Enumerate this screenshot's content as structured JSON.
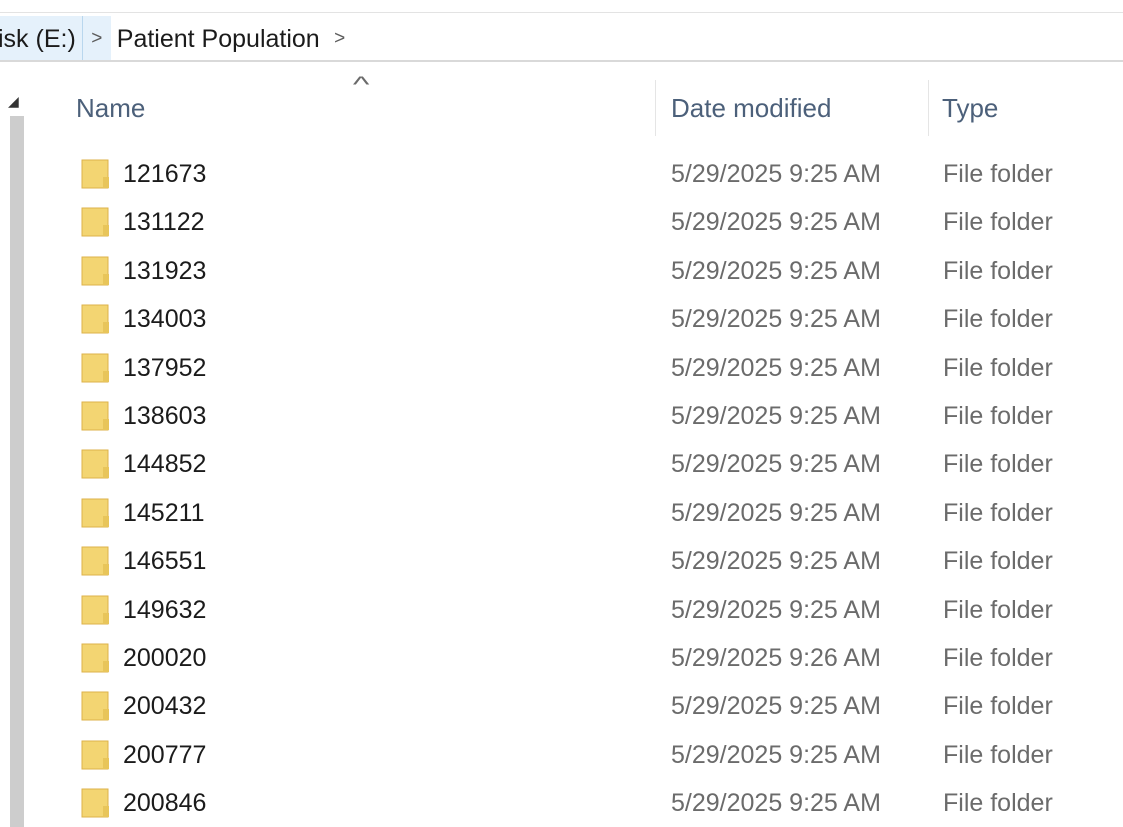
{
  "breadcrumb": {
    "previous": "isk (E:)",
    "separator_1": ">",
    "current": "Patient Population",
    "separator_2": ">"
  },
  "columns": {
    "name": "Name",
    "date_modified": "Date modified",
    "type": "Type",
    "sort_indicator": "^"
  },
  "icons": {
    "folder": "folder-icon",
    "sort_ascending": "sort-ascending-icon",
    "folder_color": "#f3d572",
    "folder_border": "#dcb24a"
  },
  "rows": [
    {
      "name": "121673",
      "date": "5/29/2025 9:25 AM",
      "type": "File folder"
    },
    {
      "name": "131122",
      "date": "5/29/2025 9:25 AM",
      "type": "File folder"
    },
    {
      "name": "131923",
      "date": "5/29/2025 9:25 AM",
      "type": "File folder"
    },
    {
      "name": "134003",
      "date": "5/29/2025 9:25 AM",
      "type": "File folder"
    },
    {
      "name": "137952",
      "date": "5/29/2025 9:25 AM",
      "type": "File folder"
    },
    {
      "name": "138603",
      "date": "5/29/2025 9:25 AM",
      "type": "File folder"
    },
    {
      "name": "144852",
      "date": "5/29/2025 9:25 AM",
      "type": "File folder"
    },
    {
      "name": "145211",
      "date": "5/29/2025 9:25 AM",
      "type": "File folder"
    },
    {
      "name": "146551",
      "date": "5/29/2025 9:25 AM",
      "type": "File folder"
    },
    {
      "name": "149632",
      "date": "5/29/2025 9:25 AM",
      "type": "File folder"
    },
    {
      "name": "200020",
      "date": "5/29/2025 9:26 AM",
      "type": "File folder"
    },
    {
      "name": "200432",
      "date": "5/29/2025 9:25 AM",
      "type": "File folder"
    },
    {
      "name": "200777",
      "date": "5/29/2025 9:25 AM",
      "type": "File folder"
    },
    {
      "name": "200846",
      "date": "5/29/2025 9:25 AM",
      "type": "File folder"
    }
  ]
}
